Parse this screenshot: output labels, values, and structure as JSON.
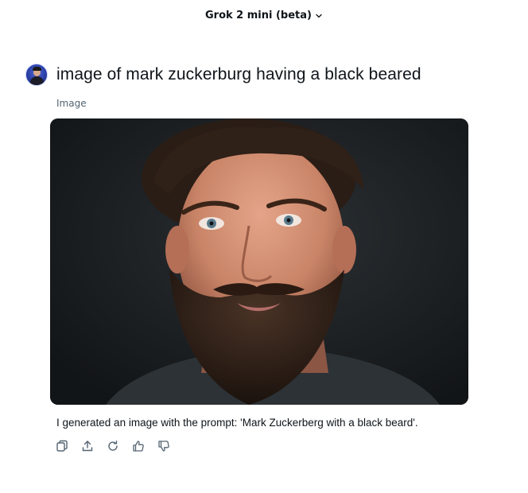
{
  "header": {
    "model_label": "Grok 2 mini (beta)"
  },
  "conversation": {
    "user_prompt": "image of mark zuckerburg having a black beared",
    "attachment_label": "Image",
    "response_text": "I generated an image with the prompt: 'Mark Zuckerberg with a black beard'."
  },
  "actions": [
    {
      "name": "copy",
      "icon": "copy-icon"
    },
    {
      "name": "share",
      "icon": "share-icon"
    },
    {
      "name": "regenerate",
      "icon": "regenerate-icon"
    },
    {
      "name": "like",
      "icon": "thumbs-up-icon"
    },
    {
      "name": "dislike",
      "icon": "thumbs-down-icon"
    }
  ],
  "colors": {
    "text": "#0f1419",
    "muted": "#536471",
    "background": "#ffffff"
  }
}
